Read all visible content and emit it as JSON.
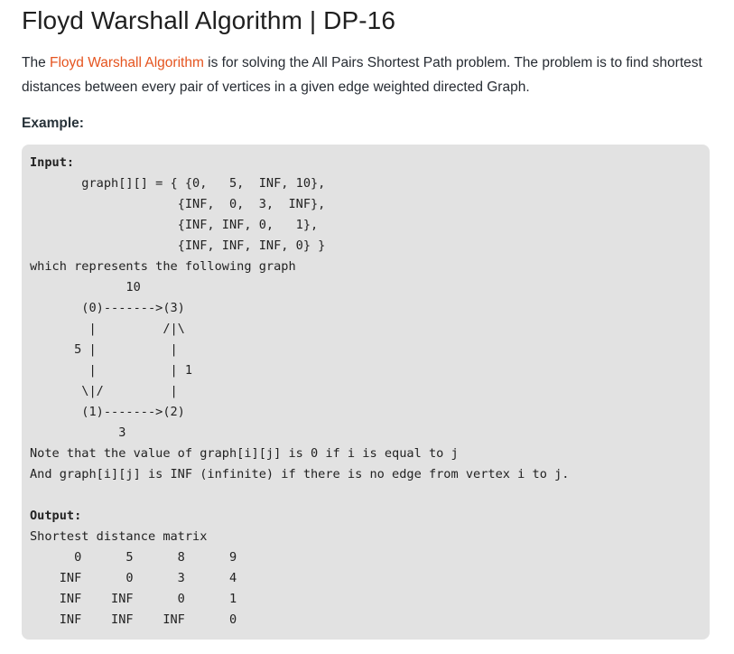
{
  "article": {
    "title": "Floyd Warshall Algorithm | DP-16",
    "intro": {
      "before_link": "The ",
      "link_text": "Floyd Warshall Algorithm",
      "after_link": " is for solving the All Pairs Shortest Path problem. The problem is to find shortest distances between every pair of vertices in a given edge weighted directed Graph."
    },
    "example_label": "Example:"
  },
  "code": {
    "input_label": "Input:",
    "input_lines": [
      "       graph[][] = { {0,   5,  INF, 10},",
      "                    {INF,  0,  3,  INF},",
      "                    {INF, INF, 0,   1},",
      "                    {INF, INF, INF, 0} }",
      "which represents the following graph",
      "             10",
      "       (0)------->(3)",
      "        |         /|\\",
      "      5 |          |",
      "        |          | 1",
      "       \\|/         |",
      "       (1)------->(2)",
      "            3",
      "Note that the value of graph[i][j] is 0 if i is equal to j",
      "And graph[i][j] is INF (infinite) if there is no edge from vertex i to j.",
      ""
    ],
    "output_label": "Output:",
    "output_lines": [
      "Shortest distance matrix",
      "      0      5      8      9",
      "    INF      0      3      4",
      "    INF    INF      0      1",
      "    INF    INF    INF      0"
    ]
  },
  "colors": {
    "link": "#e5541f",
    "code_background": "#e2e2e2",
    "text": "#272c33"
  }
}
